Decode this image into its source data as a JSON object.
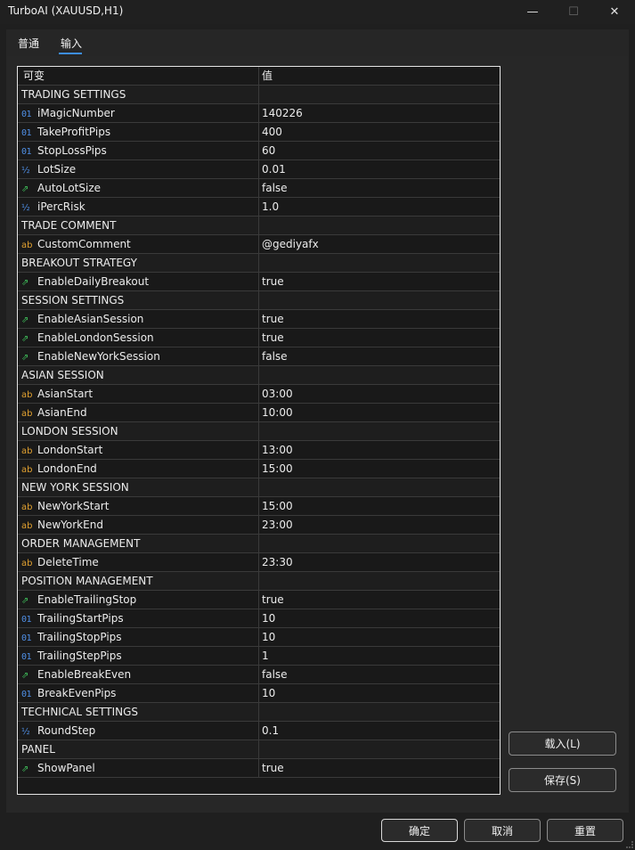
{
  "window": {
    "title": "TurboAI (XAUUSD,H1)",
    "minimize_glyph": "—",
    "maximize_glyph": "☐",
    "close_glyph": "✕"
  },
  "tabs": [
    {
      "label": "普通",
      "active": false
    },
    {
      "label": "输入",
      "active": true
    }
  ],
  "grid": {
    "col_name": "可变",
    "col_value": "值",
    "rows": [
      {
        "kind": "section",
        "name": "TRADING SETTINGS"
      },
      {
        "kind": "int",
        "name": "iMagicNumber",
        "value": "140226"
      },
      {
        "kind": "int",
        "name": "TakeProfitPips",
        "value": "400"
      },
      {
        "kind": "int",
        "name": "StopLossPips",
        "value": "60"
      },
      {
        "kind": "double",
        "name": "LotSize",
        "value": "0.01"
      },
      {
        "kind": "bool",
        "name": "AutoLotSize",
        "value": "false"
      },
      {
        "kind": "double",
        "name": "iPercRisk",
        "value": "1.0"
      },
      {
        "kind": "section",
        "name": "TRADE COMMENT"
      },
      {
        "kind": "string",
        "name": "CustomComment",
        "value": "@gediyafx"
      },
      {
        "kind": "section",
        "name": "BREAKOUT STRATEGY"
      },
      {
        "kind": "bool",
        "name": "EnableDailyBreakout",
        "value": "true"
      },
      {
        "kind": "section",
        "name": "SESSION SETTINGS"
      },
      {
        "kind": "bool",
        "name": "EnableAsianSession",
        "value": "true"
      },
      {
        "kind": "bool",
        "name": "EnableLondonSession",
        "value": "true"
      },
      {
        "kind": "bool",
        "name": "EnableNewYorkSession",
        "value": "false"
      },
      {
        "kind": "section",
        "name": "ASIAN SESSION"
      },
      {
        "kind": "string",
        "name": "AsianStart",
        "value": "03:00"
      },
      {
        "kind": "string",
        "name": "AsianEnd",
        "value": "10:00"
      },
      {
        "kind": "section",
        "name": "LONDON SESSION"
      },
      {
        "kind": "string",
        "name": "LondonStart",
        "value": "13:00"
      },
      {
        "kind": "string",
        "name": "LondonEnd",
        "value": "15:00"
      },
      {
        "kind": "section",
        "name": "NEW YORK SESSION"
      },
      {
        "kind": "string",
        "name": "NewYorkStart",
        "value": "15:00"
      },
      {
        "kind": "string",
        "name": "NewYorkEnd",
        "value": "23:00"
      },
      {
        "kind": "section",
        "name": "ORDER MANAGEMENT"
      },
      {
        "kind": "string",
        "name": "DeleteTime",
        "value": "23:30"
      },
      {
        "kind": "section",
        "name": "POSITION MANAGEMENT"
      },
      {
        "kind": "bool",
        "name": "EnableTrailingStop",
        "value": "true"
      },
      {
        "kind": "int",
        "name": "TrailingStartPips",
        "value": "10"
      },
      {
        "kind": "int",
        "name": "TrailingStopPips",
        "value": "10"
      },
      {
        "kind": "int",
        "name": "TrailingStepPips",
        "value": "1"
      },
      {
        "kind": "bool",
        "name": "EnableBreakEven",
        "value": "false"
      },
      {
        "kind": "int",
        "name": "BreakEvenPips",
        "value": "10"
      },
      {
        "kind": "section",
        "name": "TECHNICAL SETTINGS"
      },
      {
        "kind": "double",
        "name": "RoundStep",
        "value": "0.1"
      },
      {
        "kind": "section",
        "name": "PANEL"
      },
      {
        "kind": "bool",
        "name": "ShowPanel",
        "value": "true"
      }
    ]
  },
  "icons": {
    "int": {
      "glyph": "01",
      "name": "integer-type-icon",
      "color": "#4f8fe6"
    },
    "double": {
      "glyph": "½",
      "name": "double-type-icon",
      "color": "#4f8fe6"
    },
    "bool": {
      "glyph": "⇗",
      "name": "boolean-type-icon",
      "color": "#3fbf5a"
    },
    "string": {
      "glyph": "ab",
      "name": "string-type-icon",
      "color": "#e0a030"
    }
  },
  "buttons": {
    "load": "载入(L)",
    "save": "保存(S)",
    "ok": "确定",
    "cancel": "取消",
    "reset": "重置"
  },
  "colors": {
    "accent": "#3c8ee8",
    "background": "#1f1f1f",
    "grid_background": "#191919"
  }
}
